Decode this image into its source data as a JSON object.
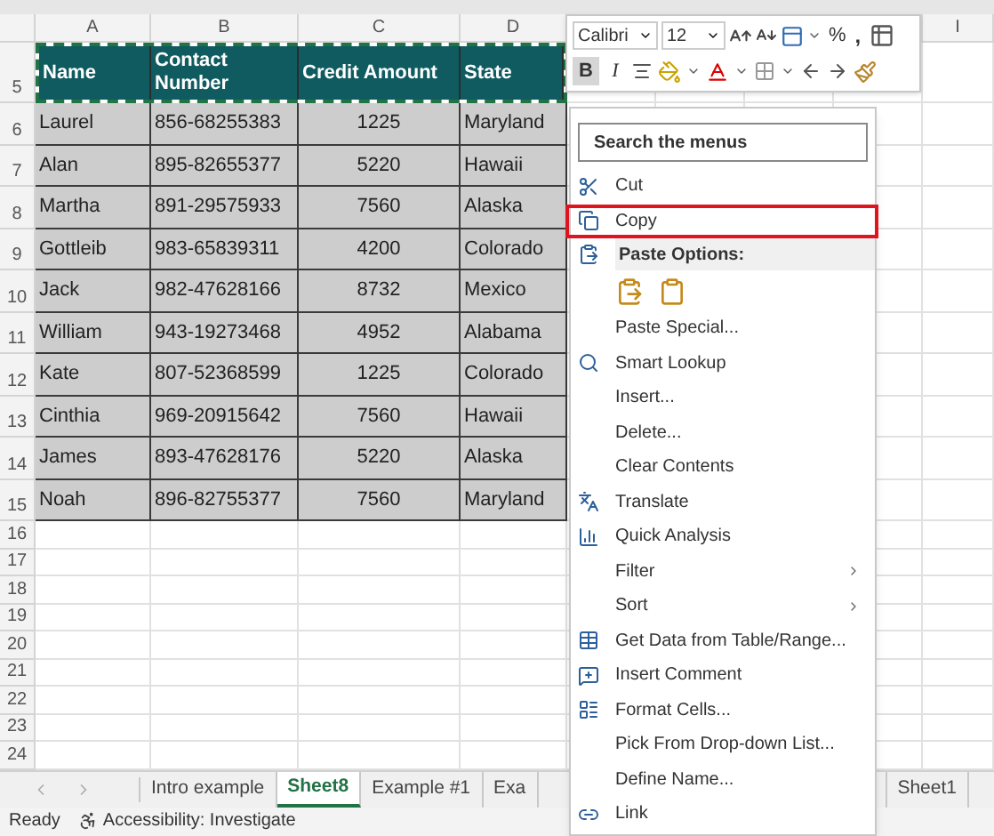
{
  "sheet": {
    "columns": [
      {
        "label": "A"
      },
      {
        "label": "B"
      },
      {
        "label": "C"
      },
      {
        "label": "D"
      },
      {
        "label": "I"
      }
    ],
    "header_row": {
      "number": "5",
      "cells": [
        "Name",
        "Contact Number",
        "Credit Amount",
        "State"
      ]
    },
    "rows": [
      {
        "number": "6",
        "cells": [
          "Laurel",
          "856-68255383",
          "1225",
          "Maryland"
        ]
      },
      {
        "number": "7",
        "cells": [
          "Alan",
          "895-82655377",
          "5220",
          "Hawaii"
        ]
      },
      {
        "number": "8",
        "cells": [
          "Martha",
          "891-29575933",
          "7560",
          "Alaska"
        ]
      },
      {
        "number": "9",
        "cells": [
          "Gottleib",
          "983-65839311",
          "4200",
          "Colorado"
        ]
      },
      {
        "number": "10",
        "cells": [
          "Jack",
          "982-47628166",
          "8732",
          "Mexico"
        ]
      },
      {
        "number": "11",
        "cells": [
          "William",
          "943-19273468",
          "4952",
          "Alabama"
        ]
      },
      {
        "number": "12",
        "cells": [
          "Kate",
          "807-52368599",
          "1225",
          "Colorado"
        ]
      },
      {
        "number": "13",
        "cells": [
          "Cinthia",
          "969-20915642",
          "7560",
          "Hawaii"
        ]
      },
      {
        "number": "14",
        "cells": [
          "James",
          "893-47628176",
          "5220",
          "Alaska"
        ]
      },
      {
        "number": "15",
        "cells": [
          "Noah",
          "896-82755377",
          "7560",
          "Maryland"
        ]
      }
    ],
    "empty_rows": [
      "16",
      "17",
      "18",
      "19",
      "20",
      "21",
      "22",
      "23",
      "24"
    ]
  },
  "mini_toolbar": {
    "font": "Calibri",
    "size": "12",
    "bold": {
      "label": "B",
      "pressed": true
    },
    "italic": {
      "label": "I"
    },
    "percent": "%",
    "comma": ","
  },
  "context_menu": {
    "search_placeholder": "Search the menus",
    "items": [
      {
        "kind": "item",
        "label": "Cut",
        "highlighted": false,
        "submenu": false
      },
      {
        "kind": "item",
        "label": "Copy",
        "highlighted": true,
        "submenu": false
      },
      {
        "kind": "header",
        "label": "Paste Options:"
      },
      {
        "kind": "paste-icons"
      },
      {
        "kind": "item",
        "label": "Paste Special...",
        "highlighted": false,
        "submenu": false
      },
      {
        "kind": "item",
        "label": "Smart Lookup",
        "highlighted": false,
        "submenu": false
      },
      {
        "kind": "item",
        "label": "Insert...",
        "highlighted": false,
        "submenu": false
      },
      {
        "kind": "item",
        "label": "Delete...",
        "highlighted": false,
        "submenu": false
      },
      {
        "kind": "item",
        "label": "Clear Contents",
        "highlighted": false,
        "submenu": false
      },
      {
        "kind": "item",
        "label": "Translate",
        "highlighted": false,
        "submenu": false
      },
      {
        "kind": "item",
        "label": "Quick Analysis",
        "highlighted": false,
        "submenu": false
      },
      {
        "kind": "item",
        "label": "Filter",
        "highlighted": false,
        "submenu": true
      },
      {
        "kind": "item",
        "label": "Sort",
        "highlighted": false,
        "submenu": true
      },
      {
        "kind": "item",
        "label": "Get Data from Table/Range...",
        "highlighted": false,
        "submenu": false
      },
      {
        "kind": "item",
        "label": "Insert Comment",
        "highlighted": false,
        "submenu": false
      },
      {
        "kind": "item",
        "label": "Format Cells...",
        "highlighted": false,
        "submenu": false
      },
      {
        "kind": "item",
        "label": "Pick From Drop-down List...",
        "highlighted": false,
        "submenu": false
      },
      {
        "kind": "item",
        "label": "Define Name...",
        "highlighted": false,
        "submenu": false
      },
      {
        "kind": "item",
        "label": "Link",
        "highlighted": false,
        "submenu": false
      }
    ]
  },
  "sheet_tabs": [
    {
      "label": "Intro example",
      "selected": false
    },
    {
      "label": "Sheet8",
      "selected": true
    },
    {
      "label": "Example #1",
      "selected": false
    },
    {
      "label": "Exa",
      "selected": false
    },
    {
      "label": "Sheet1",
      "selected": false
    }
  ],
  "status_bar": {
    "status": "Ready",
    "accessibility": "Accessibility: Investigate"
  }
}
